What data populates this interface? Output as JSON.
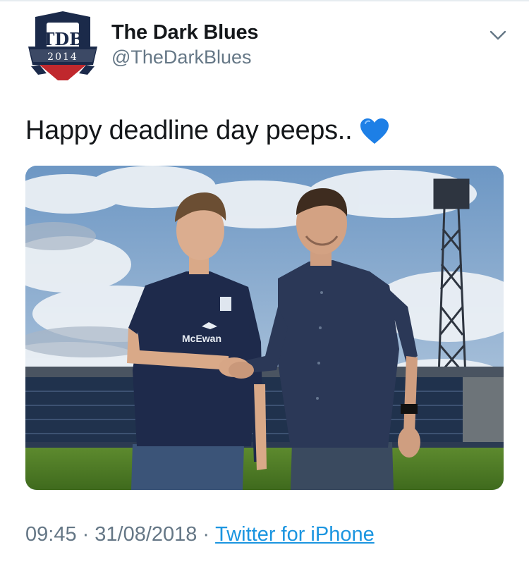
{
  "account": {
    "display_name": "The Dark Blues",
    "handle": "@TheDarkBlues",
    "avatar_monogram": "TDB",
    "avatar_year": "2014"
  },
  "tweet": {
    "text": "Happy deadline day peeps..",
    "emoji": "blue-heart",
    "time": "09:45",
    "date": "31/08/2018",
    "separator": "·",
    "source": "Twitter for iPhone"
  },
  "media": {
    "shirt_sponsor": "McEwan"
  },
  "icons": {
    "menu": "chevron-down-icon",
    "heart": "blue-heart-icon"
  },
  "colors": {
    "primary_text": "#14171a",
    "secondary_text": "#657786",
    "link": "#1b95e0",
    "heart": "#1d7fe6",
    "club_navy": "#1b2a4a",
    "club_red": "#c0282d"
  }
}
